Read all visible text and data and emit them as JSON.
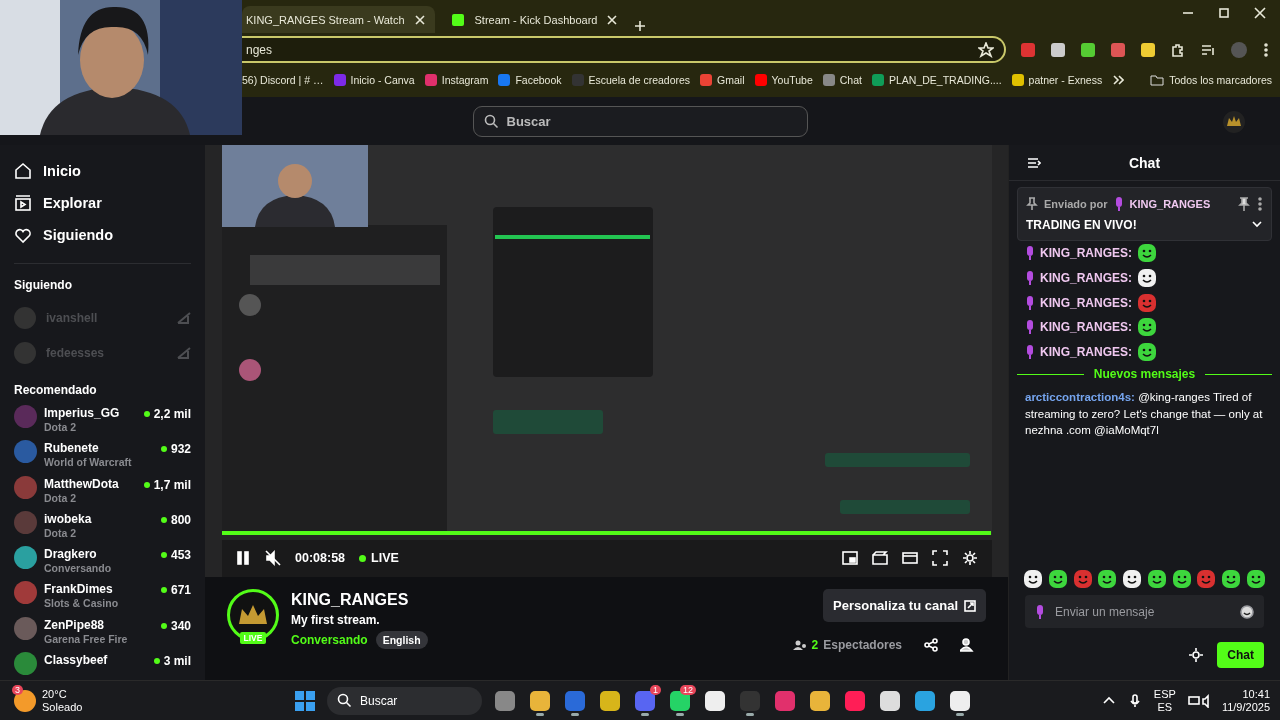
{
  "browser": {
    "tabs": [
      {
        "title": "KING_RANGES Stream - Watch",
        "selected": true
      },
      {
        "title": "Stream - Kick Dashboard",
        "selected": false
      }
    ],
    "address": "nges",
    "bookmarks": [
      "56) Discord | # …",
      "Inicio - Canva",
      "Instagram",
      "Facebook",
      "Escuela de creadores",
      "Gmail",
      "YouTube",
      "Chat",
      "PLAN_DE_TRADING....",
      "patner - Exness"
    ],
    "all_bookmarks": "Todos los marcadores"
  },
  "topbar": {
    "search_placeholder": "Buscar"
  },
  "sidebar": {
    "nav": [
      {
        "kind": "home",
        "label": "Inicio"
      },
      {
        "kind": "explore",
        "label": "Explorar"
      },
      {
        "kind": "following",
        "label": "Siguiendo"
      }
    ],
    "following_title": "Siguiendo",
    "following": [
      {
        "name": "ivanshell",
        "live": false
      },
      {
        "name": "fedeesses",
        "live": false
      }
    ],
    "recommended_title": "Recomendado",
    "recommended": [
      {
        "name": "Imperius_GG",
        "category": "Dota 2",
        "viewers": "2,2 mil"
      },
      {
        "name": "Rubenete",
        "category": "World of Warcraft",
        "viewers": "932"
      },
      {
        "name": "MatthewDota",
        "category": "Dota 2",
        "viewers": "1,7 mil"
      },
      {
        "name": "iwobeka",
        "category": "Dota 2",
        "viewers": "800"
      },
      {
        "name": "Dragkero",
        "category": "Conversando",
        "viewers": "453"
      },
      {
        "name": "FrankDimes",
        "category": "Slots & Casino",
        "viewers": "671"
      },
      {
        "name": "ZenPipe88",
        "category": "Garena Free Fire",
        "viewers": "340"
      },
      {
        "name": "Classybeef",
        "viewers": "3 mil"
      }
    ]
  },
  "player": {
    "playing": true,
    "muted": true,
    "time": "00:08:58",
    "live_label": "LIVE",
    "level": 1
  },
  "channel": {
    "name": "KING_RANGES",
    "live_badge": "LIVE",
    "title": "My first stream.",
    "category": "Conversando",
    "tag": "English",
    "customize_button": "Personaliza tu canal",
    "viewer_count": "2",
    "viewers_label": "Espectadores"
  },
  "chat": {
    "title": "Chat",
    "pinned": {
      "sent_by": "Enviado por",
      "author": "KING_RANGES",
      "text": "TRADING EN VIVO!"
    },
    "messages": [
      {
        "user": "KING_RANGES:",
        "color": "#f0c8f0",
        "badge": true
      },
      {
        "user": "KING_RANGES:",
        "color": "#f0c8f0",
        "badge": true
      },
      {
        "user": "KING_RANGES:",
        "color": "#f0c8f0",
        "badge": true
      },
      {
        "user": "KING_RANGES:",
        "color": "#f0c8f0",
        "badge": true
      },
      {
        "user": "KING_RANGES:",
        "color": "#f0c8f0",
        "badge": true
      }
    ],
    "new_messages": "Nuevos mensajes",
    "new": [
      {
        "user": "arcticcontraction4s:",
        "color": "#75a4ee",
        "badge": false,
        "text": "@king-ranges Tired of streaming to zero? Let's change that — only at nezhna .com @iaMoMqt7l"
      }
    ],
    "input_placeholder": "Enviar un mensaje",
    "send_button": "Chat"
  },
  "taskbar": {
    "weather_badge": "3",
    "temperature": "20°C",
    "weather": "Soleado",
    "search_placeholder": "Buscar",
    "apps": [
      {
        "running": false
      },
      {
        "running": true
      },
      {
        "running": true
      },
      {
        "running": false
      },
      {
        "running": true,
        "badge": "1"
      },
      {
        "running": true,
        "badge": "12"
      },
      {
        "running": false
      },
      {
        "running": true
      },
      {
        "running": false
      },
      {
        "running": false
      },
      {
        "running": false
      },
      {
        "running": false
      },
      {
        "running": false
      },
      {
        "running": true
      }
    ],
    "language": "ESP",
    "layout": "ES",
    "time": "10:41",
    "date": "11/9/2025"
  }
}
